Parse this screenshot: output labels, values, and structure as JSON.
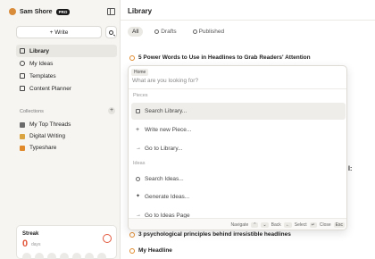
{
  "sidebar": {
    "user_name": "Sam Shore",
    "badge": "PRO",
    "write_label": "+ Write",
    "nav": [
      {
        "label": "Library",
        "active": true
      },
      {
        "label": "My Ideas",
        "active": false
      },
      {
        "label": "Templates",
        "active": false
      },
      {
        "label": "Content Planner",
        "active": false
      }
    ],
    "collections_label": "Collections",
    "collections": [
      {
        "label": "My Top Threads",
        "color": "#6b6b6b"
      },
      {
        "label": "Digital Writing",
        "color": "#d9a441"
      },
      {
        "label": "Typeshare",
        "color": "#e08a2c"
      }
    ],
    "streak": {
      "label": "Streak",
      "value": "0",
      "unit": "days"
    }
  },
  "main": {
    "title": "Library",
    "tabs": [
      {
        "label": "All",
        "active": true
      },
      {
        "label": "Drafts",
        "active": false
      },
      {
        "label": "Published",
        "active": false
      }
    ],
    "pieces": [
      "5 Power Words to Use in Headlines to Grab Readers' Attention",
      "3 psychological principles behind irresistible headlines",
      "My Headline"
    ],
    "behind_text": "l:"
  },
  "command_palette": {
    "chip": "Home",
    "placeholder": "What are you looking for?",
    "pieces_section": "Pieces",
    "ideas_section": "Ideas",
    "items": [
      "Search Library...",
      "Write new Piece...",
      "Go to Library...",
      "Search Ideas...",
      "Generate Ideas...",
      "Go to Ideas Page"
    ],
    "footer": {
      "navigate": "Navigate",
      "back": "Back",
      "back_key": "←",
      "select": "Select",
      "select_key": "↵",
      "close": "Close",
      "close_key": "Esc"
    }
  },
  "colors": {
    "accent": "#e08a2c",
    "streak": "#e2573b"
  }
}
